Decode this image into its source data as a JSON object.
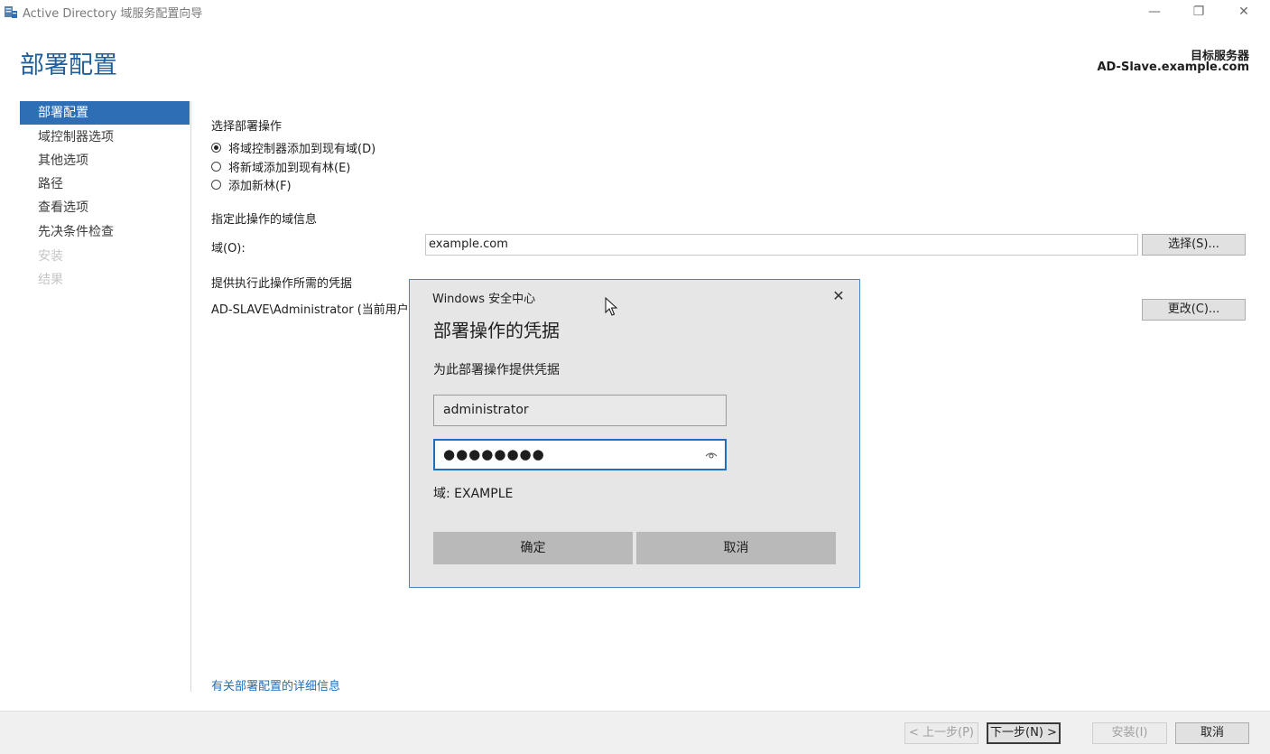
{
  "window": {
    "title": "Active Directory 域服务配置向导",
    "controls": {
      "minimize": "—",
      "restore": "❐",
      "close": "✕"
    }
  },
  "header": {
    "page_title": "部署配置",
    "target_label": "目标服务器",
    "target_server": "AD-Slave.example.com"
  },
  "sidebar": {
    "items": [
      {
        "label": "部署配置",
        "state": "active"
      },
      {
        "label": "域控制器选项",
        "state": "normal"
      },
      {
        "label": "其他选项",
        "state": "normal"
      },
      {
        "label": "路径",
        "state": "normal"
      },
      {
        "label": "查看选项",
        "state": "normal"
      },
      {
        "label": "先决条件检查",
        "state": "normal"
      },
      {
        "label": "安装",
        "state": "disabled"
      },
      {
        "label": "结果",
        "state": "disabled"
      }
    ]
  },
  "main": {
    "deploy_op_label": "选择部署操作",
    "options": [
      {
        "label": "将域控制器添加到现有域(D)",
        "checked": true
      },
      {
        "label": "将新域添加到现有林(E)",
        "checked": false
      },
      {
        "label": "添加新林(F)",
        "checked": false
      }
    ],
    "domain_info_label": "指定此操作的域信息",
    "domain_field_label": "域(O):",
    "domain_value": "example.com",
    "select_button": "选择(S)...",
    "creds_label": "提供执行此操作所需的凭据",
    "current_creds": "AD-SLAVE\\Administrator (当前用户",
    "change_button": "更改(C)...",
    "more_info_link": "有关部署配置的详细信息"
  },
  "footer": {
    "prev_button": "< 上一步(P)",
    "next_button": "下一步(N) >",
    "install_button": "安装(I)",
    "cancel_button": "取消"
  },
  "dialog": {
    "app_name": "Windows 安全中心",
    "close": "✕",
    "title": "部署操作的凭据",
    "prompt": "为此部署操作提供凭据",
    "username": "administrator",
    "password_mask": "●●●●●●●●",
    "domain_text": "域: EXAMPLE",
    "ok_button": "确定",
    "cancel_button": "取消"
  },
  "colors": {
    "accent": "#2e6eb4",
    "title_blue": "#1f5f9d",
    "link": "#1f6fbf",
    "dialog_border": "#4a86c7"
  }
}
